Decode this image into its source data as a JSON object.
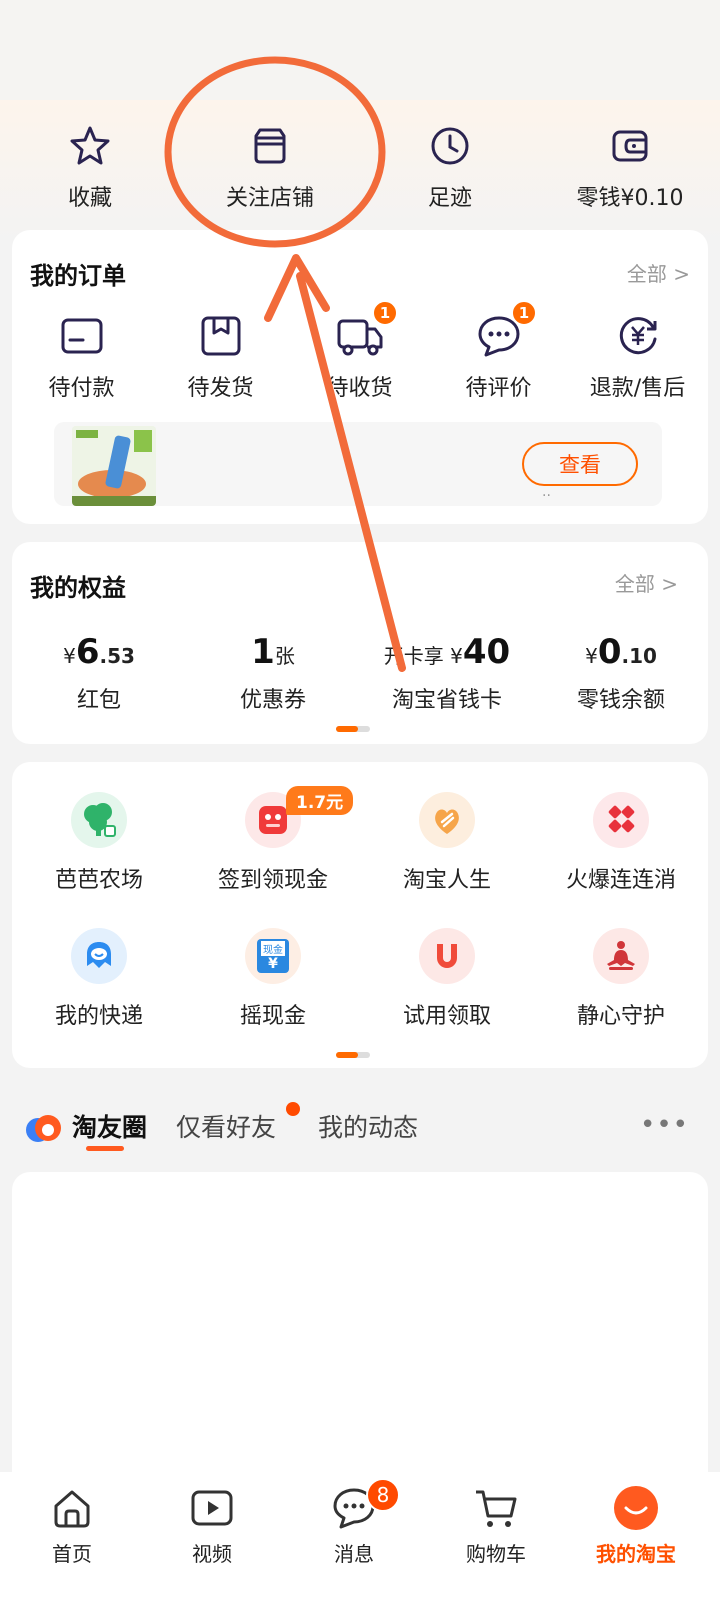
{
  "quick_actions": [
    {
      "label": "收藏",
      "icon": "star-icon"
    },
    {
      "label": "关注店铺",
      "icon": "store-icon"
    },
    {
      "label": "足迹",
      "icon": "clock-icon"
    },
    {
      "label": "零钱¥0.10",
      "icon": "wallet-icon"
    }
  ],
  "orders": {
    "title": "我的订单",
    "more": "全部 >",
    "items": [
      {
        "label": "待付款",
        "icon": "card-icon",
        "badge": ""
      },
      {
        "label": "待发货",
        "icon": "box-icon",
        "badge": ""
      },
      {
        "label": "待收货",
        "icon": "truck-icon",
        "badge": "1"
      },
      {
        "label": "待评价",
        "icon": "comment-icon",
        "badge": "1"
      },
      {
        "label": "退款/售后",
        "icon": "refund-icon",
        "badge": ""
      }
    ],
    "promo_button": "查看"
  },
  "benefits": {
    "title": "我的权益",
    "more": "全部 >",
    "items": [
      {
        "prefix": "¥ ",
        "value": "6",
        "suffix": ".53",
        "label": "红包"
      },
      {
        "prefix": "",
        "value": "1",
        "suffix": "张",
        "label": "优惠券"
      },
      {
        "prefix": "开卡享 ¥ ",
        "value": "40",
        "suffix": "",
        "label": "淘宝省钱卡"
      },
      {
        "prefix": "¥",
        "value": "0",
        "suffix": ".10",
        "label": "零钱余额"
      }
    ]
  },
  "services": [
    {
      "label": "芭芭农场",
      "icon": "farm-tree-icon",
      "tag": ""
    },
    {
      "label": "签到领现金",
      "icon": "checkin-icon",
      "tag": "1.7元"
    },
    {
      "label": "淘宝人生",
      "icon": "life-icon",
      "tag": ""
    },
    {
      "label": "火爆连连消",
      "icon": "match-game-icon",
      "tag": ""
    },
    {
      "label": "我的快递",
      "icon": "courier-icon",
      "tag": ""
    },
    {
      "label": "摇现金",
      "icon": "cash-icon",
      "tag": ""
    },
    {
      "label": "试用领取",
      "icon": "magnet-icon",
      "tag": ""
    },
    {
      "label": "静心守护",
      "icon": "meditation-icon",
      "tag": ""
    }
  ],
  "cash_icon_text": "现金",
  "feed_tabs": {
    "active": "淘友圈",
    "friends": "仅看好友",
    "mine": "我的动态"
  },
  "tabbar": [
    {
      "label": "首页",
      "icon": "home-icon",
      "badge": ""
    },
    {
      "label": "视频",
      "icon": "video-icon",
      "badge": ""
    },
    {
      "label": "消息",
      "icon": "message-icon",
      "badge": "8"
    },
    {
      "label": "购物车",
      "icon": "cart-icon",
      "badge": ""
    },
    {
      "label": "我的淘宝",
      "icon": "my-taobao-icon",
      "badge": ""
    }
  ],
  "colors": {
    "accent": "#ff5000",
    "annotation": "#f26b3a"
  }
}
